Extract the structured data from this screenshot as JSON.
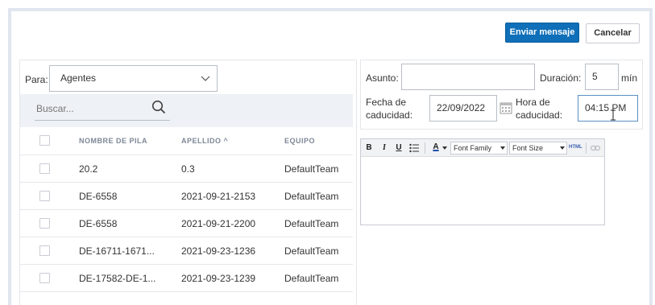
{
  "header": {
    "send_label": "Enviar mensaje",
    "cancel_label": "Cancelar",
    "accent": "#0f6fb8"
  },
  "recipients": {
    "to_label": "Para:",
    "to_value": "Agentes",
    "search_placeholder": "Buscar...",
    "columns": [
      "NOMBRE DE PILA",
      "APELLIDO ^",
      "EQUIPO"
    ],
    "rows": [
      {
        "first_name": "20.2",
        "last_name": "0.3",
        "team": "DefaultTeam"
      },
      {
        "first_name": "DE-6558",
        "last_name": "2021-09-21-2153",
        "team": "DefaultTeam"
      },
      {
        "first_name": "DE-6558",
        "last_name": "2021-09-21-2200",
        "team": "DefaultTeam"
      },
      {
        "first_name": "DE-16711-1671...",
        "last_name": "2021-09-23-1236",
        "team": "DefaultTeam"
      },
      {
        "first_name": "DE-17582-DE-1...",
        "last_name": "2021-09-23-1239",
        "team": "DefaultTeam"
      }
    ]
  },
  "message": {
    "subject_label": "Asunto:",
    "subject_value": "",
    "duration_label": "Duración:",
    "duration_value": "5",
    "duration_unit": "mín",
    "expiry_date_label_line1": "Fecha de",
    "expiry_date_label_line2": "caducidad:",
    "expiry_date_value": "22/09/2022",
    "expiry_time_label_line1": "Hora de",
    "expiry_time_label_line2": "caducidad:",
    "expiry_time_value": "04:15 PM"
  },
  "editor": {
    "bold": "B",
    "italic": "I",
    "underline": "U",
    "font_color_glyph": "A",
    "font_family": "Font Family",
    "font_size": "Font Size",
    "html_label": "HTML",
    "body": ""
  }
}
